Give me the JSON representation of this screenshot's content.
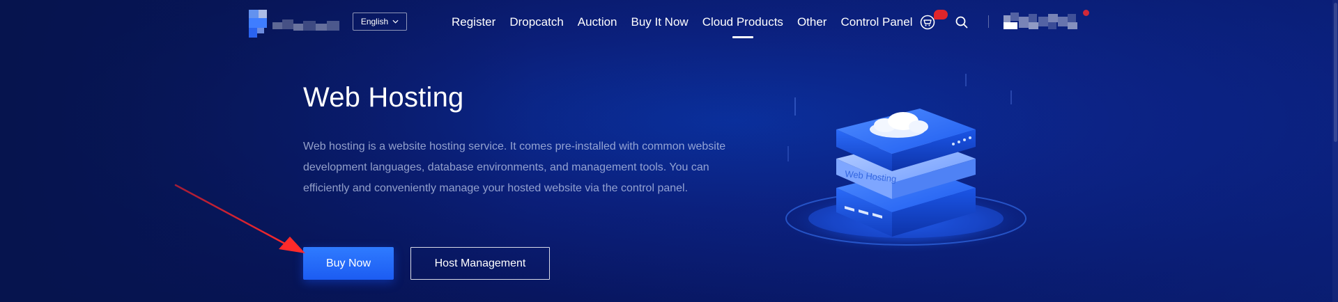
{
  "header": {
    "language": "English",
    "nav": [
      {
        "label": "Register",
        "active": false
      },
      {
        "label": "Dropcatch",
        "active": false
      },
      {
        "label": "Auction",
        "active": false
      },
      {
        "label": "Buy It Now",
        "active": false
      },
      {
        "label": "Cloud Products",
        "active": true
      },
      {
        "label": "Other",
        "active": false
      },
      {
        "label": "Control Panel",
        "active": false
      }
    ],
    "icons": {
      "logo": "brand-logo",
      "language_caret": "chevron-down-icon",
      "cart": "cart-icon",
      "search": "search-icon",
      "user": "user-avatar"
    }
  },
  "hero": {
    "title": "Web Hosting",
    "description": "Web hosting is a website hosting service. It comes pre-installed with common website development languages, database environments, and management tools. You can efficiently and conveniently manage your hosted website via the control panel.",
    "buy_label": "Buy Now",
    "host_label": "Host Management",
    "illustration_label": "Web Hosting"
  },
  "colors": {
    "accent": "#1f63f5",
    "badge": "#e0252b",
    "background": "#0b1f7a",
    "annotation_arrow": "#e8202a"
  }
}
